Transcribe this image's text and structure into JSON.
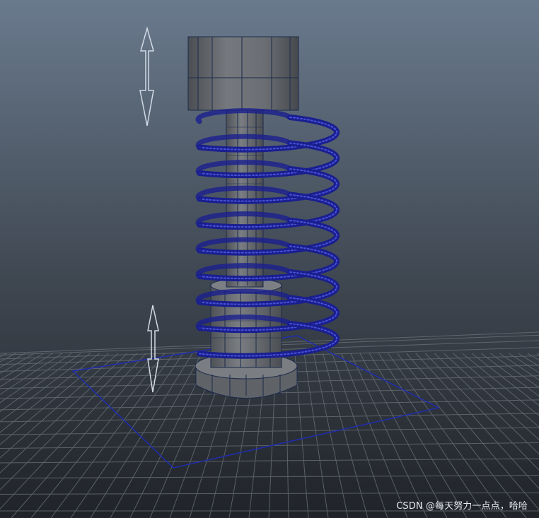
{
  "viewport": {
    "label": "3D scene viewport",
    "background_top": "#67778a",
    "background_bottom": "#23272c"
  },
  "scene": {
    "objects": [
      "bolt-head",
      "bolt-shaft",
      "bolt-lower-collar",
      "bolt-base-nut",
      "coil-spring",
      "selection-square",
      "ground-grid"
    ],
    "manipulators": [
      "vertical-move-arrow-top",
      "vertical-move-arrow-bottom"
    ],
    "colors": {
      "mesh_fill": "#6b6f74",
      "mesh_wire": "#1c2a4a",
      "spring_wire": "#1a1f8f",
      "selection": "#1f2db0",
      "grid": "#6c737a",
      "arrow": "#d2dae4"
    }
  },
  "watermark": {
    "text": "CSDN @每天努力一点点，哈哈"
  }
}
